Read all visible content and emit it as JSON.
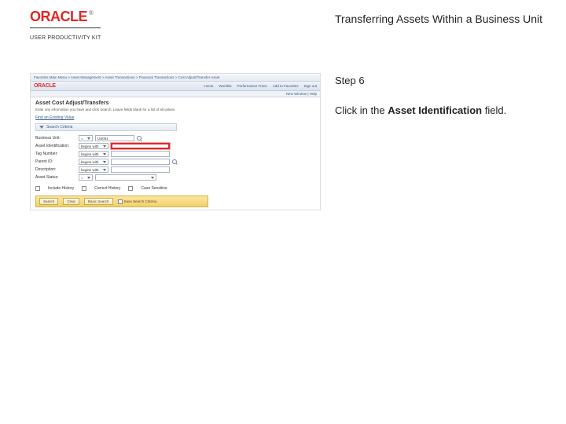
{
  "header": {
    "logo_text": "ORACLE",
    "logo_tm": "®",
    "upk_label": "USER PRODUCTIVITY KIT",
    "page_title": "Transferring Assets Within a Business Unit"
  },
  "instructions": {
    "step_label": "Step 6",
    "text_prefix": "Click in the ",
    "text_bold": "Asset Identification",
    "text_suffix": " field."
  },
  "screenshot": {
    "breadcrumb_left": "Favorites    Main Menu > Asset Management > Asset Transactions > Financial Transactions > Cost Adjust/Transfer Asset",
    "oracle_logo": "ORACLE",
    "nav_items": [
      "Home",
      "Worklist",
      "Performance Trace",
      "Add to Favorites",
      "Sign out"
    ],
    "subbar": "New Window | Help",
    "page_heading": "Asset Cost Adjust/Transfers",
    "description": "Enter any information you have and click Search. Leave fields blank for a list of all values.",
    "link": "Find an Existing Value",
    "collapse_label": "Search Criteria",
    "form": {
      "business_unit": {
        "label": "Business Unit:",
        "op": "=",
        "value": "US001"
      },
      "asset_id": {
        "label": "Asset Identification:",
        "op": "begins with",
        "value": ""
      },
      "tag_number": {
        "label": "Tag Number:",
        "op": "begins with",
        "value": ""
      },
      "parent_id": {
        "label": "Parent ID:",
        "op": "begins with",
        "value": ""
      },
      "description": {
        "label": "Description:",
        "op": "begins with",
        "value": ""
      },
      "asset_status": {
        "label": "Asset Status:",
        "op": "=",
        "value": ""
      },
      "chk_include": "Include History",
      "chk_correct": "Correct History",
      "chk_case": "Case Sensitive"
    },
    "buttons": {
      "search": "Search",
      "clear": "Clear",
      "basic": "Basic Search",
      "save_chk": "Save Search Criteria"
    }
  }
}
